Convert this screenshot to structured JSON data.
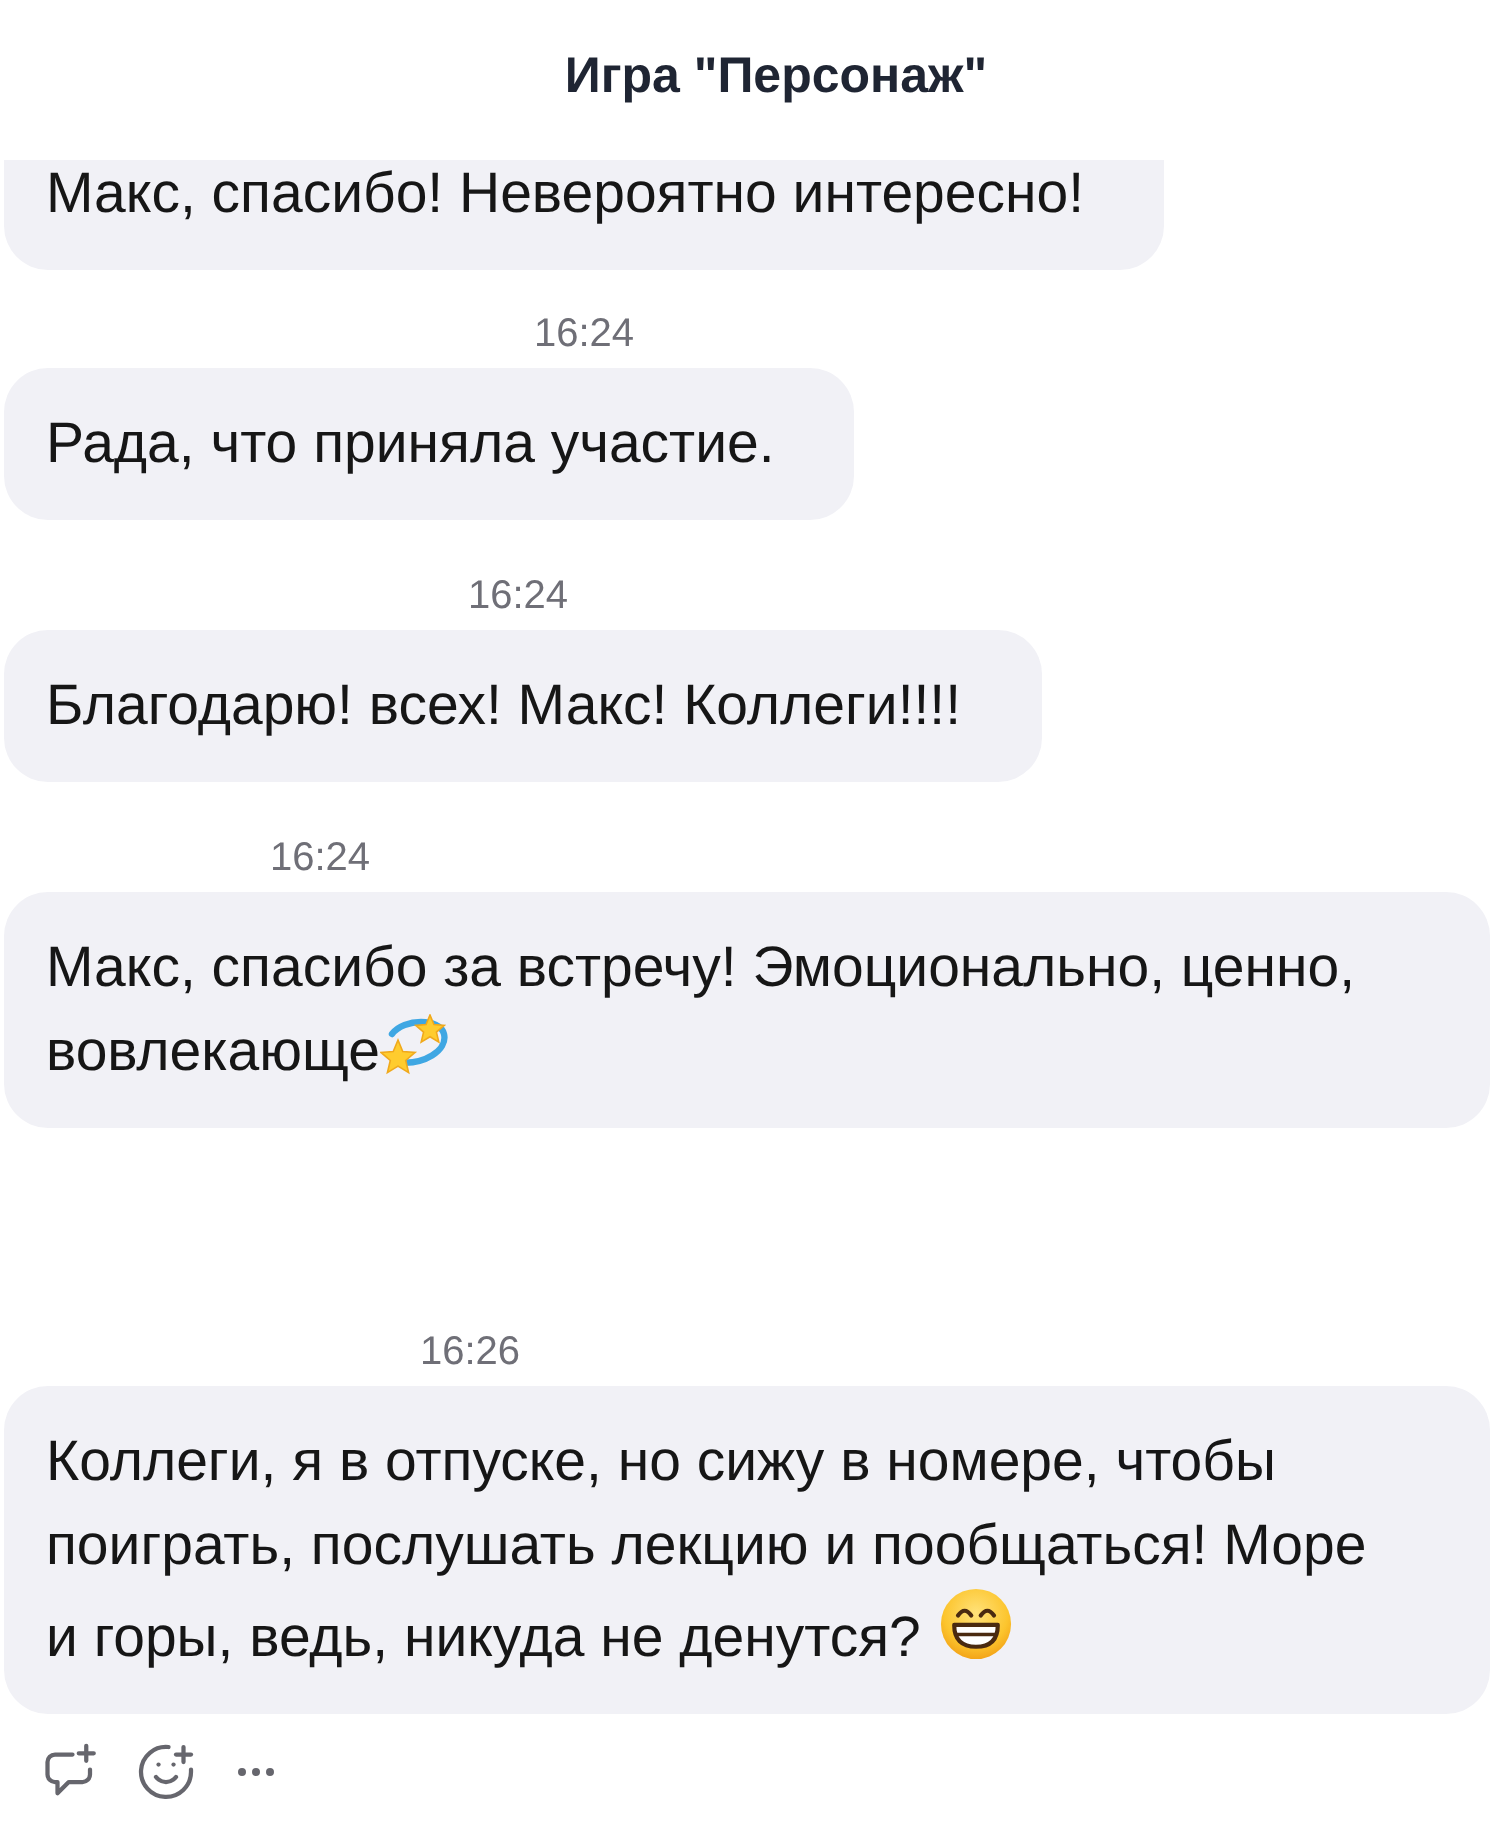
{
  "header": {
    "title": "Игра \"Персонаж\""
  },
  "messages": [
    {
      "kind": "plain",
      "lines": [
        "Макс, спасибо! Невероятно интересно!"
      ]
    },
    {
      "kind": "plain",
      "time": "16:24",
      "lines": [
        "Рада, что приняла участие."
      ]
    },
    {
      "kind": "plain",
      "time": "16:24",
      "lines": [
        "Благодарю! всех! Макс! Коллеги!!!!"
      ]
    },
    {
      "kind": "dizzy",
      "time": "16:24",
      "lines": [
        "Макс, спасибо за встречу! Эмоционально, ценно,",
        "вовлекающе"
      ]
    },
    {
      "kind": "grin",
      "time": "16:26",
      "lines": [
        "Коллеги, я в отпуске, но сижу в номере, чтобы",
        "поиграть, послушать лекцию и пообщаться! Море",
        "и горы, ведь, никуда не денутся?"
      ]
    }
  ]
}
